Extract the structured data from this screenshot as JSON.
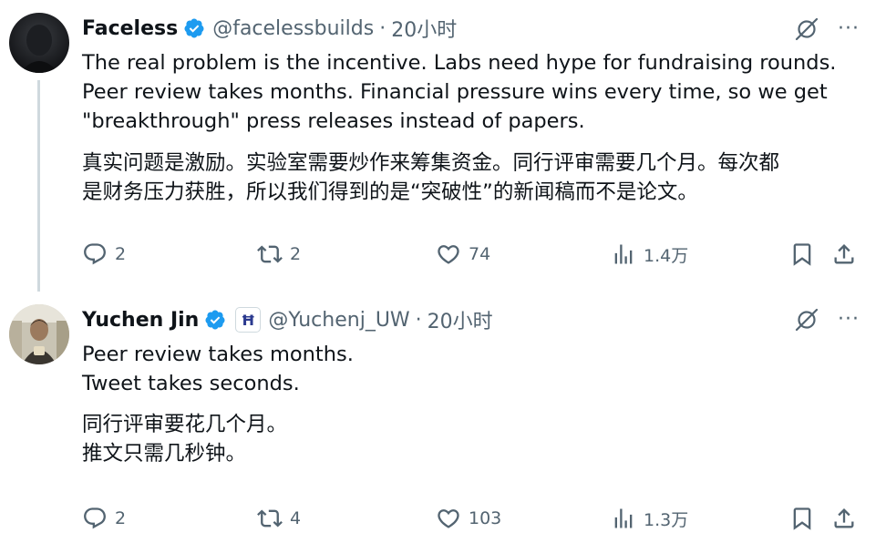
{
  "tweets": [
    {
      "author": {
        "name": "Faceless",
        "handle": "@facelessbuilds",
        "verified": true
      },
      "time": "20小时",
      "text_en": [
        "The real problem is the incentive. Labs need hype for fundraising rounds.",
        "Peer review takes months. Financial pressure wins every time, so we get",
        "\"breakthrough\" press releases instead of papers."
      ],
      "text_zh": [
        "真实问题是激励。实验室需要炒作来筹集资金。同行评审需要几个月。每次都",
        "是财务压力获胜，所以我们得到的是“突破性”的新闻稿而不是论文。"
      ],
      "actions": {
        "replies": "2",
        "reposts": "2",
        "likes": "74",
        "views": "1.4万"
      },
      "icons": [
        "grok-icon",
        "more-icon",
        "reply-icon",
        "repost-icon",
        "like-icon",
        "views-icon",
        "bookmark-icon",
        "share-icon"
      ]
    },
    {
      "author": {
        "name": "Yuchen Jin",
        "handle": "@Yuchenj_UW",
        "verified": true,
        "affiliation_badge": "Ħ"
      },
      "time": "20小时",
      "text_en": [
        "Peer review takes months.",
        "Tweet takes seconds."
      ],
      "text_zh": [
        "同行评审要花几个月。",
        "推文只需几秒钟。"
      ],
      "actions": {
        "replies": "2",
        "reposts": "4",
        "likes": "103",
        "views": "1.3万"
      },
      "icons": [
        "grok-icon",
        "more-icon",
        "reply-icon",
        "repost-icon",
        "like-icon",
        "views-icon",
        "bookmark-icon",
        "share-icon"
      ]
    }
  ],
  "colors": {
    "text": "#0f1419",
    "secondary": "#536471",
    "verified": "#1d9bf0",
    "thread_line": "#cfd9de"
  },
  "separator": "·",
  "more_glyph": "···"
}
